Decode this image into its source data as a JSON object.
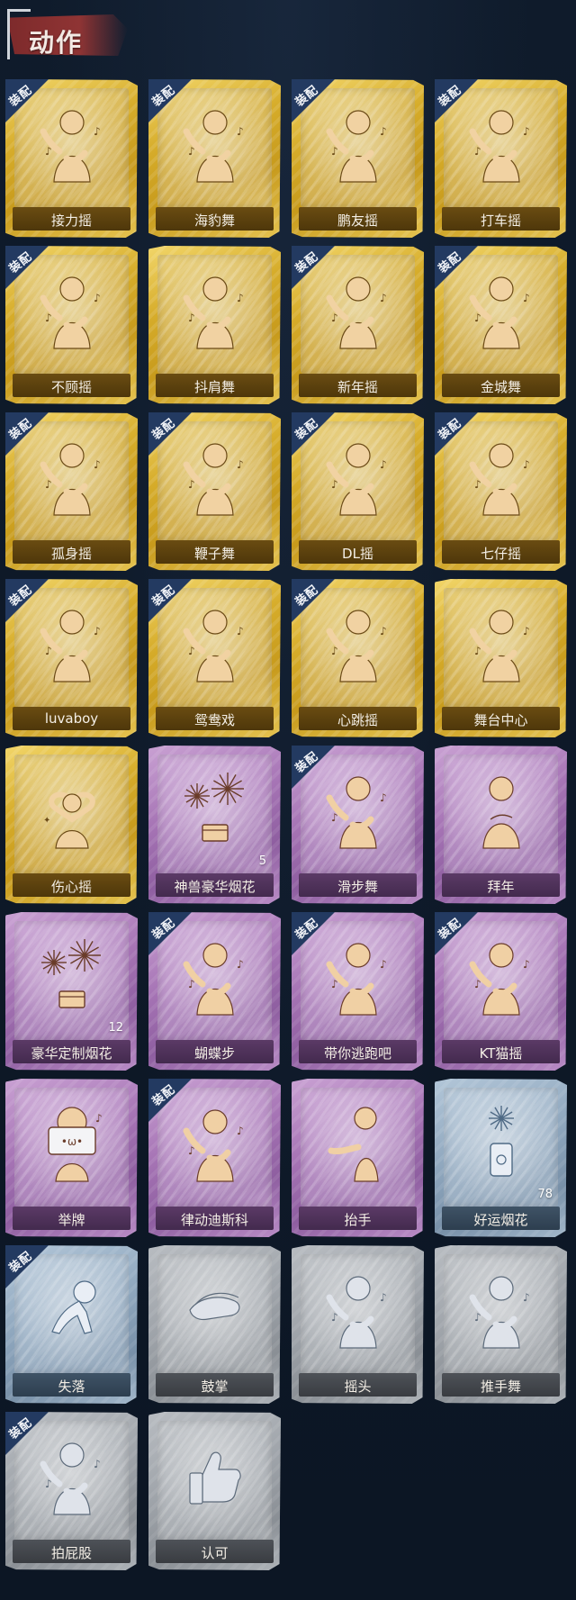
{
  "header": {
    "title": "动作"
  },
  "equip_tag": "装配",
  "colors": {
    "gold": "#d6ac2a",
    "purple": "#a674b5",
    "blue": "#8ea6bd",
    "gray": "#9ea3a9",
    "equip_tag": "#233a61",
    "header_banner": "#8f3434"
  },
  "cards": [
    {
      "label": "接力摇",
      "tier": "gold",
      "equipped": true,
      "count": "",
      "icon": "dance-pose-icon"
    },
    {
      "label": "海豹舞",
      "tier": "gold",
      "equipped": true,
      "count": "",
      "icon": "dance-pose-icon"
    },
    {
      "label": "鹏友摇",
      "tier": "gold",
      "equipped": true,
      "count": "",
      "icon": "dance-pose-icon"
    },
    {
      "label": "打车摇",
      "tier": "gold",
      "equipped": true,
      "count": "",
      "icon": "dance-pose-icon"
    },
    {
      "label": "不顾摇",
      "tier": "gold",
      "equipped": true,
      "count": "",
      "icon": "dance-pose-icon"
    },
    {
      "label": "抖肩舞",
      "tier": "gold",
      "equipped": false,
      "count": "",
      "icon": "dance-pose-icon"
    },
    {
      "label": "新年摇",
      "tier": "gold",
      "equipped": true,
      "count": "",
      "icon": "dance-pose-icon"
    },
    {
      "label": "金城舞",
      "tier": "gold",
      "equipped": true,
      "count": "",
      "icon": "dance-pose-icon"
    },
    {
      "label": "孤身摇",
      "tier": "gold",
      "equipped": true,
      "count": "",
      "icon": "dance-pose-icon"
    },
    {
      "label": "鞭子舞",
      "tier": "gold",
      "equipped": true,
      "count": "",
      "icon": "dance-pose-icon"
    },
    {
      "label": "DL摇",
      "tier": "gold",
      "equipped": true,
      "count": "",
      "icon": "dance-pose-icon"
    },
    {
      "label": "七仔摇",
      "tier": "gold",
      "equipped": true,
      "count": "",
      "icon": "dance-pose-icon"
    },
    {
      "label": "luvaboy",
      "tier": "gold",
      "equipped": true,
      "count": "",
      "icon": "dance-pose-icon"
    },
    {
      "label": "鸳鸯戏",
      "tier": "gold",
      "equipped": true,
      "count": "",
      "icon": "dance-pose-icon"
    },
    {
      "label": "心跳摇",
      "tier": "gold",
      "equipped": true,
      "count": "",
      "icon": "dance-pose-icon"
    },
    {
      "label": "舞台中心",
      "tier": "gold",
      "equipped": false,
      "count": "",
      "icon": "dance-pose-icon"
    },
    {
      "label": "伤心摇",
      "tier": "gold",
      "equipped": false,
      "count": "",
      "icon": "heart-pose-icon"
    },
    {
      "label": "神兽豪华烟花",
      "tier": "purple",
      "equipped": false,
      "count": "5",
      "icon": "fireworks-icon"
    },
    {
      "label": "滑步舞",
      "tier": "purple",
      "equipped": true,
      "count": "",
      "icon": "dance-pose-icon"
    },
    {
      "label": "拜年",
      "tier": "purple",
      "equipped": false,
      "count": "",
      "icon": "bow-pose-icon"
    },
    {
      "label": "豪华定制烟花",
      "tier": "purple",
      "equipped": false,
      "count": "12",
      "icon": "fireworks-icon"
    },
    {
      "label": "蝴蝶步",
      "tier": "purple",
      "equipped": true,
      "count": "",
      "icon": "dance-pose-icon"
    },
    {
      "label": "带你逃跑吧",
      "tier": "purple",
      "equipped": true,
      "count": "",
      "icon": "dance-pose-icon"
    },
    {
      "label": "KT猫摇",
      "tier": "purple",
      "equipped": true,
      "count": "",
      "icon": "dance-pose-icon"
    },
    {
      "label": "举牌",
      "tier": "purple",
      "equipped": false,
      "count": "",
      "icon": "sign-pose-icon"
    },
    {
      "label": "律动迪斯科",
      "tier": "purple",
      "equipped": true,
      "count": "",
      "icon": "dance-pose-icon"
    },
    {
      "label": "抬手",
      "tier": "purple",
      "equipped": false,
      "count": "",
      "icon": "hand-raise-icon"
    },
    {
      "label": "好运烟花",
      "tier": "blue",
      "equipped": false,
      "count": "78",
      "icon": "firework-can-icon"
    },
    {
      "label": "失落",
      "tier": "blue",
      "equipped": true,
      "count": "",
      "icon": "crawl-pose-icon"
    },
    {
      "label": "鼓掌",
      "tier": "gray",
      "equipped": false,
      "count": "",
      "icon": "clap-hands-icon"
    },
    {
      "label": "摇头",
      "tier": "gray",
      "equipped": false,
      "count": "",
      "icon": "dance-pose-icon"
    },
    {
      "label": "推手舞",
      "tier": "gray",
      "equipped": false,
      "count": "",
      "icon": "dance-pose-icon"
    },
    {
      "label": "拍屁股",
      "tier": "gray",
      "equipped": true,
      "count": "",
      "icon": "dance-pose-icon"
    },
    {
      "label": "认可",
      "tier": "gray",
      "equipped": false,
      "count": "",
      "icon": "thumbs-up-icon"
    }
  ]
}
